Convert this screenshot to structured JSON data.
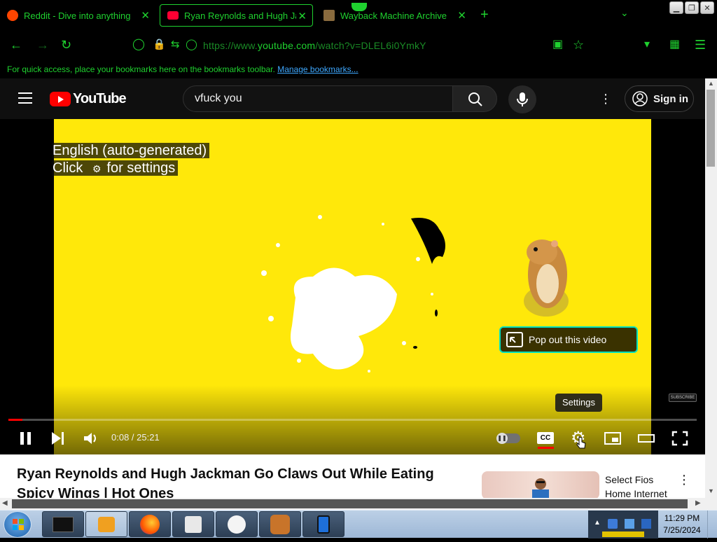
{
  "browser": {
    "tabs": [
      {
        "title": "Reddit - Dive into anything",
        "favicon": "reddit-icon",
        "active": false
      },
      {
        "title": "Ryan Reynolds and Hugh Jackman",
        "favicon": "youtube-icon",
        "active": true
      },
      {
        "title": "Wayback Machine Archive",
        "favicon": "archive-icon",
        "active": false
      }
    ],
    "url_prefix": "https://www.",
    "url_domain": "youtube.com",
    "url_path": "/watch?v=DLEL6i0YmkY",
    "bookmarks_hint": "For quick access, place your bookmarks here on the bookmarks toolbar.",
    "bookmarks_link": "Manage bookmarks...",
    "accent_color": "#1fd12f"
  },
  "youtube": {
    "logo_text": "YouTube",
    "search_value": "vfuck you",
    "sign_in_label": "Sign in",
    "player": {
      "caption_line1": "English (auto-generated)",
      "caption_line2_prefix": "Click",
      "caption_line2_suffix": "for settings",
      "popout_label": "Pop out this video",
      "settings_tooltip": "Settings",
      "subscribe_watermark": "SUBSCRIBE",
      "current_time": "0:08",
      "duration": "25:21",
      "progress_fraction": 0.005,
      "cc_label": "CC"
    },
    "video_title": "Ryan Reynolds and Hugh Jackman Go Claws Out While Eating Spicy Wings | Hot Ones",
    "ad": {
      "title_line1": "Select Fios",
      "title_line2": "Home Internet"
    }
  },
  "taskbar": {
    "time": "11:29 PM",
    "date": "7/25/2024"
  }
}
